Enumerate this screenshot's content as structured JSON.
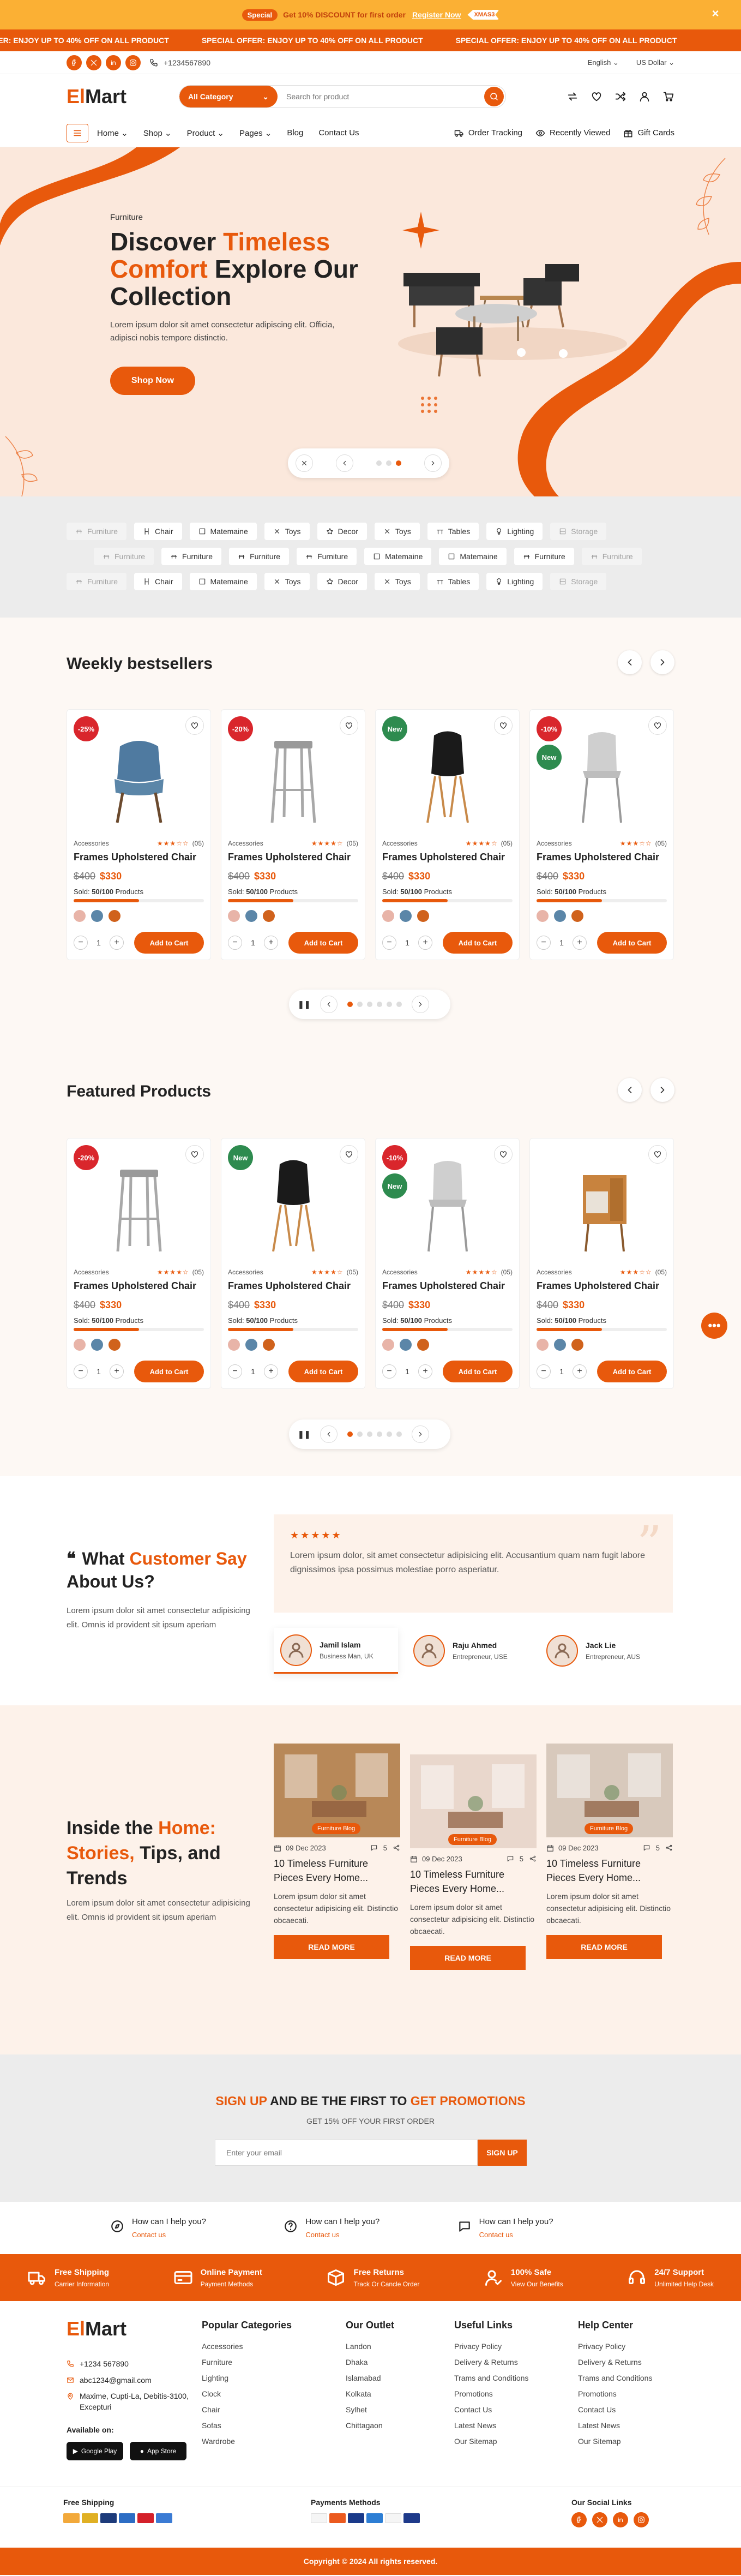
{
  "promo": {
    "special": "Special",
    "text": "Get 10% DISCOUNT for first order",
    "register": "Register Now",
    "coupon": "XMAS3",
    "close": "×"
  },
  "ticker": [
    "SPECIAL OFFER: ENJOY UP TO 40% OFF ON ALL PRODUCT",
    "SPECIAL OFFER: ENJOY UP TO 40% OFF ON ALL PRODUCT",
    "SPECIAL OFFER: ENJOY UP TO 40% OFF ON ALL PRODUCT"
  ],
  "header": {
    "phone": "+1234567890",
    "language": "English",
    "currency": "US Dollar",
    "logo_first": "El",
    "logo_rest": "Mart",
    "category_label": "All Category",
    "search_placeholder": "Search for product",
    "nav": [
      "Home",
      "Shop",
      "Product",
      "Pages",
      "Blog",
      "Contact Us"
    ],
    "right_links": [
      "Order Tracking",
      "Recently Viewed",
      "Gift Cards"
    ]
  },
  "hero": {
    "subtitle": "Furniture",
    "title_a": "Discover ",
    "title_b": "Timeless",
    "title_c": "Comfort",
    "title_d": " Explore Our Collection",
    "description": "Lorem ipsum dolor sit amet consectetur adipiscing elit. Officia, adipisci nobis tempore distinctio.",
    "button": "Shop Now"
  },
  "tags": [
    [
      "Furniture",
      "Chair",
      "Matemaine",
      "Toys",
      "Decor",
      "Toys",
      "Tables",
      "Lighting",
      "Storage"
    ],
    [
      "Furniture",
      "Furniture",
      "Furniture",
      "Furniture",
      "Matemaine",
      "Matemaine",
      "Furniture",
      "Furniture"
    ],
    [
      "Furniture",
      "Chair",
      "Matemaine",
      "Toys",
      "Decor",
      "Toys",
      "Tables",
      "Lighting",
      "Storage"
    ]
  ],
  "bestsellers": {
    "title": "Weekly bestsellers",
    "products": [
      {
        "badge": "-25%",
        "badge2": "",
        "category": "Accessories",
        "rating": 3,
        "reviews": "(05)",
        "name": "Frames Upholstered Chair",
        "old": "$400",
        "new": "$330",
        "sold_label": "Sold:",
        "sold": "50/100",
        "sold_suffix": "Products",
        "progress": 0.5,
        "qty": "1",
        "cart": "Add to Cart"
      },
      {
        "badge": "-20%",
        "badge2": "",
        "category": "Accessories",
        "rating": 4,
        "reviews": "(05)",
        "name": "Frames Upholstered Chair",
        "old": "$400",
        "new": "$330",
        "sold_label": "Sold:",
        "sold": "50/100",
        "sold_suffix": "Products",
        "progress": 0.5,
        "qty": "1",
        "cart": "Add to Cart"
      },
      {
        "badge": "New",
        "badge2": "",
        "category": "Accessories",
        "rating": 4,
        "reviews": "(05)",
        "name": "Frames Upholstered Chair",
        "old": "$400",
        "new": "$330",
        "sold_label": "Sold:",
        "sold": "50/100",
        "sold_suffix": "Products",
        "progress": 0.5,
        "qty": "1",
        "cart": "Add to Cart"
      },
      {
        "badge": "-10%",
        "badge2": "New",
        "category": "Accessories",
        "rating": 3,
        "reviews": "(05)",
        "name": "Frames Upholstered Chair",
        "old": "$400",
        "new": "$330",
        "sold_label": "Sold:",
        "sold": "50/100",
        "sold_suffix": "Products",
        "progress": 0.5,
        "qty": "1",
        "cart": "Add to Cart"
      }
    ]
  },
  "featured": {
    "title": "Featured Products",
    "products": [
      {
        "badge": "-20%",
        "badge2": "",
        "category": "Accessories",
        "rating": 4,
        "reviews": "(05)",
        "name": "Frames Upholstered Chair",
        "old": "$400",
        "new": "$330",
        "sold_label": "Sold:",
        "sold": "50/100",
        "sold_suffix": "Products",
        "progress": 0.5,
        "qty": "1",
        "cart": "Add to Cart"
      },
      {
        "badge": "New",
        "badge2": "",
        "category": "Accessories",
        "rating": 4,
        "reviews": "(05)",
        "name": "Frames Upholstered Chair",
        "old": "$400",
        "new": "$330",
        "sold_label": "Sold:",
        "sold": "50/100",
        "sold_suffix": "Products",
        "progress": 0.5,
        "qty": "1",
        "cart": "Add to Cart"
      },
      {
        "badge": "-10%",
        "badge2": "New",
        "category": "Accessories",
        "rating": 4,
        "reviews": "(05)",
        "name": "Frames Upholstered Chair",
        "old": "$400",
        "new": "$330",
        "sold_label": "Sold:",
        "sold": "50/100",
        "sold_suffix": "Products",
        "progress": 0.5,
        "qty": "1",
        "cart": "Add to Cart"
      },
      {
        "badge": "",
        "badge2": "",
        "category": "Accessories",
        "rating": 3,
        "reviews": "(05)",
        "name": "Frames Upholstered Chair",
        "old": "$400",
        "new": "$330",
        "sold_label": "Sold:",
        "sold": "50/100",
        "sold_suffix": "Products",
        "progress": 0.5,
        "qty": "1",
        "cart": "Add to Cart"
      }
    ]
  },
  "swatches": [
    "#e8b4a8",
    "#5b86a8",
    "#d0621c"
  ],
  "testimonials": {
    "title_a": "What ",
    "title_b": "Customer Say",
    "title_c": " About Us?",
    "description": "Lorem ipsum dolor sit amet consectetur adipisicing elit. Omnis id provident sit ipsum aperiam",
    "stars": "★★★★★",
    "quote": "Lorem ipsum dolor, sit amet consectetur adipisicing elit. Accusantium quam nam fugit labore dignissimos ipsa possimus molestiae porro asperiatur.",
    "people": [
      {
        "name": "Jamil Islam",
        "role": "Business Man, UK"
      },
      {
        "name": "Raju Ahmed",
        "role": "Entrepreneur, USE"
      },
      {
        "name": "Jack Lie",
        "role": "Entrepreneur, AUS"
      }
    ]
  },
  "blog": {
    "title_a": "Inside the ",
    "title_b": "Home:",
    "title_c": "Stories,",
    "title_d": " Tips, and Trends",
    "description": "Lorem ipsum dolor sit amet consectetur adipisicing elit. Omnis id provident sit ipsum aperiam",
    "posts": [
      {
        "label": "Furniture Blog",
        "date": "09 Dec 2023",
        "count": "5",
        "title": "10 Timeless Furniture Pieces Every Home...",
        "text": "Lorem ipsum dolor sit amet consectetur adipisicing elit. Distinctio obcaecati.",
        "button": "READ MORE"
      },
      {
        "label": "Furniture Blog",
        "date": "09 Dec 2023",
        "count": "5",
        "title": "10 Timeless Furniture Pieces Every Home...",
        "text": "Lorem ipsum dolor sit amet consectetur adipisicing elit. Distinctio obcaecati.",
        "button": "READ MORE"
      },
      {
        "label": "Furniture Blog",
        "date": "09 Dec 2023",
        "count": "5",
        "title": "10 Timeless Furniture Pieces Every Home...",
        "text": "Lorem ipsum dolor sit amet consectetur adipisicing elit. Distinctio obcaecati.",
        "button": "READ MORE"
      }
    ]
  },
  "newsletter": {
    "title_a": "SIGN UP",
    "title_b": " AND BE THE FIRST TO ",
    "title_c": "GET PROMOTIONS",
    "sub": "GET 15% OFF YOUR FIRST ORDER",
    "placeholder": "Enter your email",
    "button": "SIGN UP"
  },
  "help": [
    {
      "title": "How can I help you?",
      "sub": "Contact us"
    },
    {
      "title": "How can I help you?",
      "sub": "Contact us"
    },
    {
      "title": "How can I help you?",
      "sub": "Contact us"
    }
  ],
  "features": [
    {
      "title": "Free Shipping",
      "sub": "Carrier Information"
    },
    {
      "title": "Online Payment",
      "sub": "Payment Methods"
    },
    {
      "title": "Free Returns",
      "sub": "Track Or Cancle Order"
    },
    {
      "title": "100% Safe",
      "sub": "View Our Benefits"
    },
    {
      "title": "24/7 Support",
      "sub": "Unlimited Help Desk"
    }
  ],
  "footer": {
    "phone": "+1234 567890",
    "email": "abc1234@gmail.com",
    "address": "Maxime, Cupti-La, Debitis-3100, Excepturi",
    "available": "Available on:",
    "google": "Google Play",
    "apple": "App Store",
    "columns": [
      {
        "title": "Popular Categories",
        "links": [
          "Accessories",
          "Furniture",
          "Lighting",
          "Clock",
          "Chair",
          "Sofas",
          "Wardrobe"
        ]
      },
      {
        "title": "Our Outlet",
        "links": [
          "Landon",
          "Dhaka",
          "Islamabad",
          "Kolkata",
          "Sylhet",
          "Chittagaon"
        ]
      },
      {
        "title": "Useful Links",
        "links": [
          "Privacy Policy",
          "Delivery & Returns",
          "Trams and Conditions",
          "Promotions",
          "Contact Us",
          "Latest News",
          "Our Sitemap"
        ]
      },
      {
        "title": "Help Center",
        "links": [
          "Privacy Policy",
          "Delivery & Returns",
          "Trams and Conditions",
          "Promotions",
          "Contact Us",
          "Latest News",
          "Our Sitemap"
        ]
      }
    ],
    "free_shipping": "Free Shipping",
    "payments": "Payments Methods",
    "social": "Our Social Links",
    "copyright": "Copyright © 2024 All rights reserved."
  },
  "colors": {
    "accent": "#e8590c",
    "promo": "#fbb034"
  }
}
